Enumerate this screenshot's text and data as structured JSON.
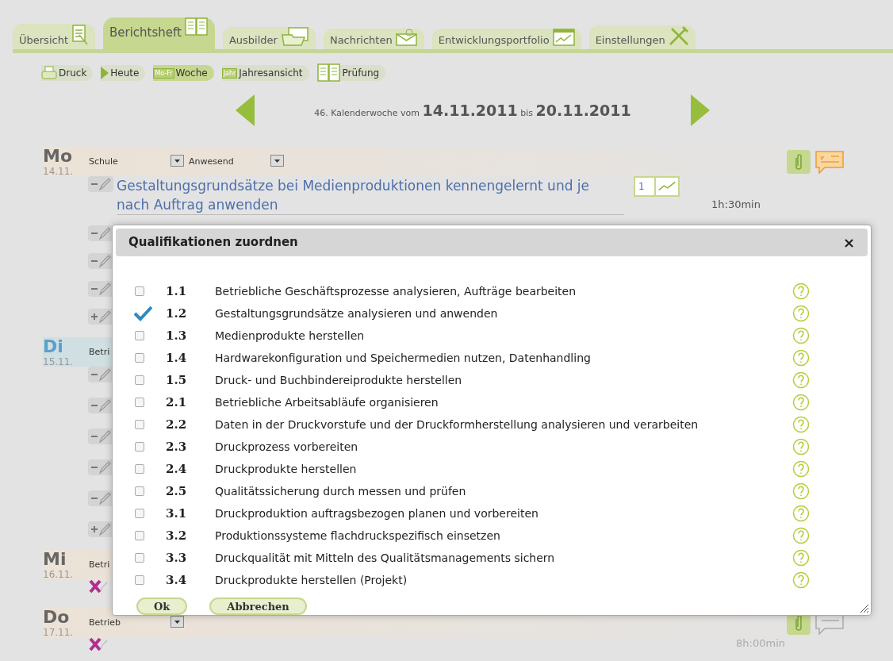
{
  "tabs": [
    {
      "label": "Übersicht",
      "selected": false
    },
    {
      "label": "Berichtsheft",
      "selected": true
    },
    {
      "label": "Ausbilder",
      "selected": false
    },
    {
      "label": "Nachrichten",
      "selected": false
    },
    {
      "label": "Entwicklungsportfolio",
      "selected": false
    },
    {
      "label": "Einstellungen",
      "selected": false
    }
  ],
  "toolbar": [
    {
      "label": "Druck",
      "selected": false
    },
    {
      "label": "Heute",
      "selected": false
    },
    {
      "label": "Woche",
      "selected": true,
      "tag": "Mo-Fr"
    },
    {
      "label": "Jahresansicht",
      "selected": false,
      "tag": "Jahr"
    },
    {
      "label": "Prüfung",
      "selected": false
    }
  ],
  "week": {
    "prefix": "46. Kalenderwoche vom",
    "from": "14.11.2011",
    "mid": "bis",
    "to": "20.11.2011"
  },
  "days": [
    {
      "name": "Mo",
      "date": "14.11.",
      "today": false,
      "place": "Schule",
      "status": "Anwesend",
      "comment_filled": true,
      "entries": [
        {
          "kind": "remove",
          "text": "Gestaltungsgrundsätze bei Medienproduktionen kennengelernt und je nach Auftrag anwenden",
          "count": "1",
          "duration": "1h:30min"
        },
        {
          "kind": "remove"
        },
        {
          "kind": "remove"
        },
        {
          "kind": "remove"
        },
        {
          "kind": "add"
        }
      ]
    },
    {
      "name": "Di",
      "date": "15.11.",
      "today": true,
      "place": "Betri",
      "entries": [
        {
          "kind": "remove"
        },
        {
          "kind": "remove"
        },
        {
          "kind": "remove"
        },
        {
          "kind": "remove"
        },
        {
          "kind": "remove"
        },
        {
          "kind": "add"
        }
      ]
    },
    {
      "name": "Mi",
      "date": "16.11.",
      "today": false,
      "place": "Betri",
      "entries": [
        {
          "kind": "delete"
        }
      ]
    },
    {
      "name": "Do",
      "date": "17.11.",
      "today": false,
      "place": "Betrieb",
      "comment_filled": false,
      "duration": "8h:00min",
      "entries": [
        {
          "kind": "delete"
        }
      ]
    }
  ],
  "dialog": {
    "title": "Qualifikationen zuordnen",
    "close": "×",
    "items": [
      {
        "number": "1.1",
        "label": "Betriebliche Geschäftsprozesse analysieren, Aufträge bearbeiten",
        "checked": false
      },
      {
        "number": "1.2",
        "label": "Gestaltungsgrundsätze analysieren und anwenden",
        "checked": true
      },
      {
        "number": "1.3",
        "label": "Medienprodukte herstellen",
        "checked": false
      },
      {
        "number": "1.4",
        "label": "Hardwarekonfiguration und Speichermedien nutzen, Datenhandling",
        "checked": false
      },
      {
        "number": "1.5",
        "label": "Druck- und Buchbindereiprodukte herstellen",
        "checked": false
      },
      {
        "number": "2.1",
        "label": "Betriebliche Arbeitsabläufe organisieren",
        "checked": false
      },
      {
        "number": "2.2",
        "label": "Daten in der Druckvorstufe und der Druckformherstellung analysieren und verarbeiten",
        "checked": false
      },
      {
        "number": "2.3",
        "label": "Druckprozess vorbereiten",
        "checked": false
      },
      {
        "number": "2.4",
        "label": "Druckprodukte herstellen",
        "checked": false
      },
      {
        "number": "2.5",
        "label": "Qualitätssicherung durch messen und prüfen",
        "checked": false
      },
      {
        "number": "3.1",
        "label": "Druckproduktion auftragsbezogen planen und vorbereiten",
        "checked": false
      },
      {
        "number": "3.2",
        "label": "Produktionssysteme flachdruckspezifisch einsetzen",
        "checked": false
      },
      {
        "number": "3.3",
        "label": "Druckqualität mit Mitteln des Qualitätsmanagements sichern",
        "checked": false
      },
      {
        "number": "3.4",
        "label": "Druckprodukte herstellen (Projekt)",
        "checked": false
      }
    ],
    "buttons": [
      "Ok",
      "Abbrechen"
    ]
  }
}
